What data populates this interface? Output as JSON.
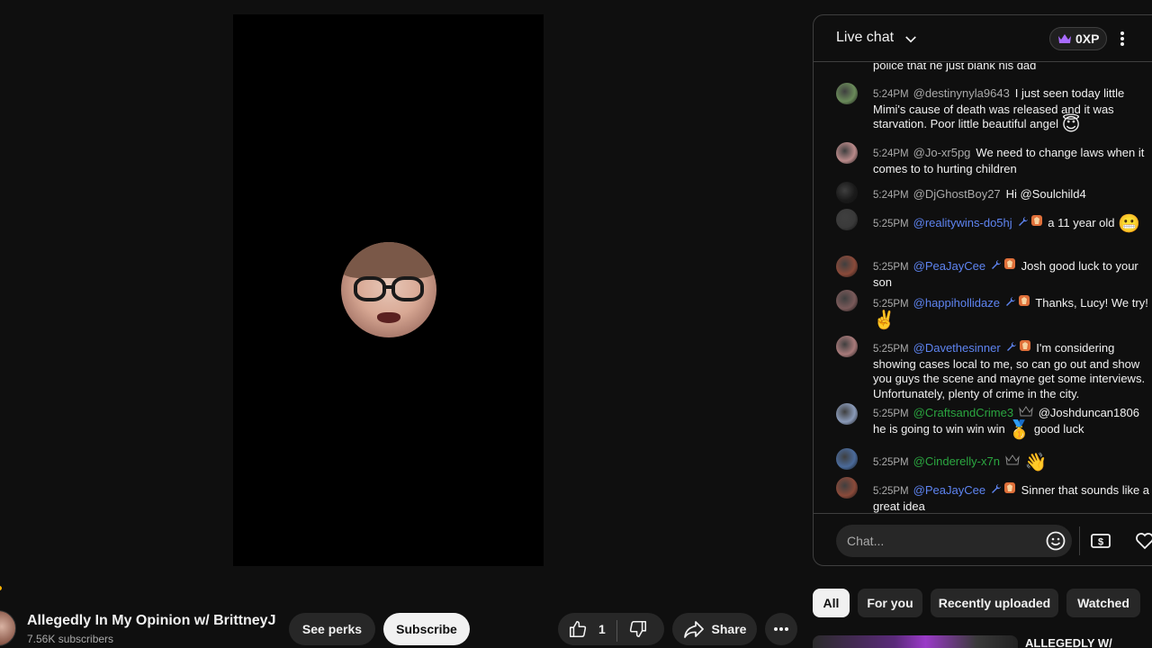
{
  "colors": {
    "background": "#0f0f0f",
    "mod_name": "#5e84f1",
    "member_name": "#2ba640",
    "text": "#f1f1f1",
    "muted": "#aaaaaa"
  },
  "chat": {
    "title": "Live chat",
    "xp": "0XP",
    "partial_message": "police that he just blank his dad",
    "messages": [
      {
        "time": "5:24PM",
        "author": "@destinynyla9643",
        "role": "viewer",
        "text": "I just seen today little Mimi's cause of death was released and it was starvation. Poor little beautiful angel",
        "emoji": "😇",
        "avatar_color": "#6a8a5a"
      },
      {
        "time": "5:24PM",
        "author": "@Jo-xr5pg",
        "role": "viewer",
        "text": "We need to change laws when it comes to to hurting children",
        "emoji": "",
        "avatar_color": "#b98a8a"
      },
      {
        "time": "5:24PM",
        "author": "@DjGhostBoy27",
        "role": "viewer",
        "text": "Hi @Soulchild4",
        "emoji": "",
        "avatar_color": "#1a1a1a"
      },
      {
        "time": "5:25PM",
        "author": "@realitywins-do5hj",
        "role": "mod",
        "text": "a 11 year old",
        "emoji": "😬",
        "avatar_color": "#3a3a3a"
      },
      {
        "time": "5:25PM",
        "author": "@PeaJayCee",
        "role": "mod",
        "text": "Josh good luck to your son",
        "emoji": "",
        "avatar_color": "#8a4a3a"
      },
      {
        "time": "5:25PM",
        "author": "@happihollidaze",
        "role": "mod",
        "text": "Thanks, Lucy! We try!",
        "emoji": "✌️",
        "avatar_color": "#7a5a5a"
      },
      {
        "time": "5:25PM",
        "author": "@Davethesinner",
        "role": "mod",
        "text": "I'm considering showing cases local to me, so can go out and show you guys the scene and mayne get some interviews. Unfortunately, plenty of crime in the city.",
        "emoji": "",
        "avatar_color": "#a87a7a"
      },
      {
        "time": "5:25PM",
        "author": "@CraftsandCrime3",
        "role": "member",
        "text": "@Joshduncan1806 he is going to win win win",
        "emoji": "🥇",
        "text_after": "good luck",
        "avatar_color": "#8a9ab8"
      },
      {
        "time": "5:25PM",
        "author": "@Cinderelly-x7n",
        "role": "member",
        "text": "",
        "emoji": "👋",
        "avatar_color": "#4a6a9a"
      },
      {
        "time": "5:25PM",
        "author": "@PeaJayCee",
        "role": "mod",
        "text": "Sinner that sounds like a great idea",
        "emoji": "",
        "avatar_color": "#8a4a3a"
      }
    ],
    "input_placeholder": "Chat..."
  },
  "channel": {
    "name": "Allegedly In My Opinion w/ BrittneyJ",
    "subscribers": "7.56K subscribers",
    "see_perks": "See perks",
    "subscribe": "Subscribe"
  },
  "actions": {
    "like_count": "1",
    "share": "Share"
  },
  "chips": [
    "All",
    "For you",
    "Recently uploaded",
    "Watched"
  ],
  "related": {
    "title": "ALLEGEDLY W/"
  }
}
